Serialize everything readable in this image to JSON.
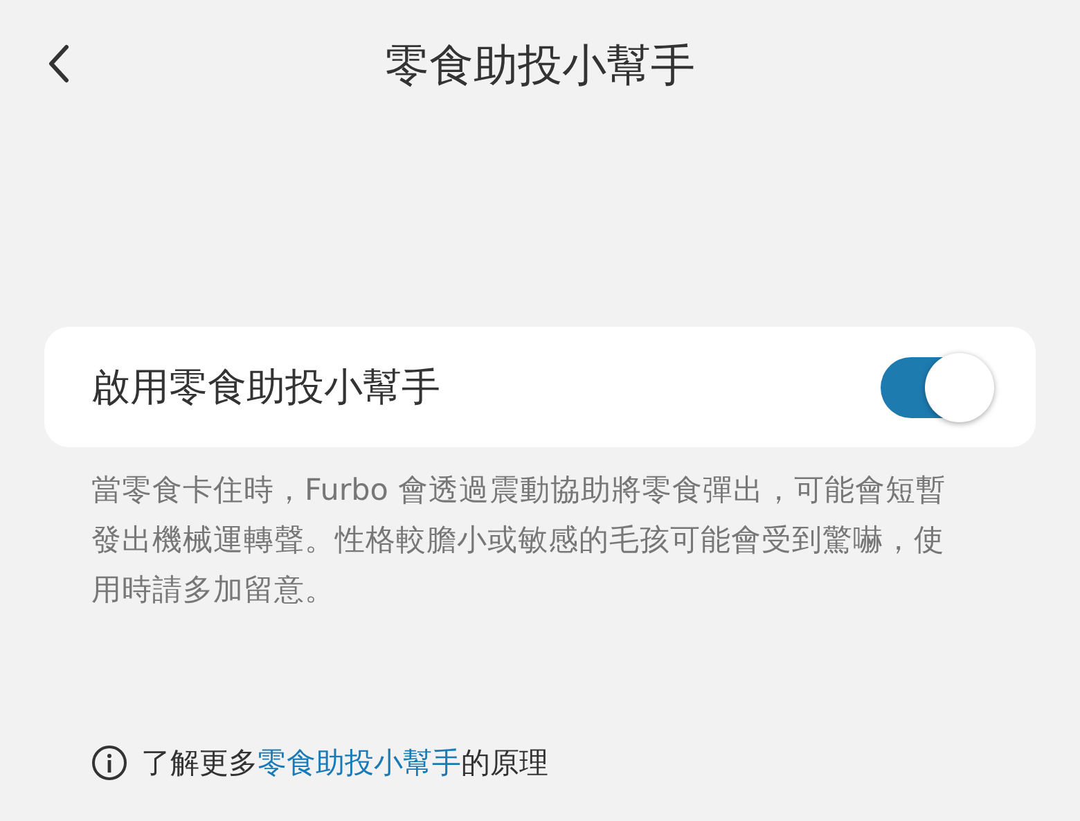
{
  "header": {
    "title": "零食助投小幫手"
  },
  "setting": {
    "label": "啟用零食助投小幫手",
    "on": true
  },
  "description": "當零食卡住時，Furbo 會透過震動協助將零食彈出，可能會短暫發出機械運轉聲。性格較膽小或敏感的毛孩可能會受到驚嚇，使用時請多加留意。",
  "info": {
    "prefix": "了解更多",
    "link": "零食助投小幫手",
    "suffix": "的原理"
  }
}
